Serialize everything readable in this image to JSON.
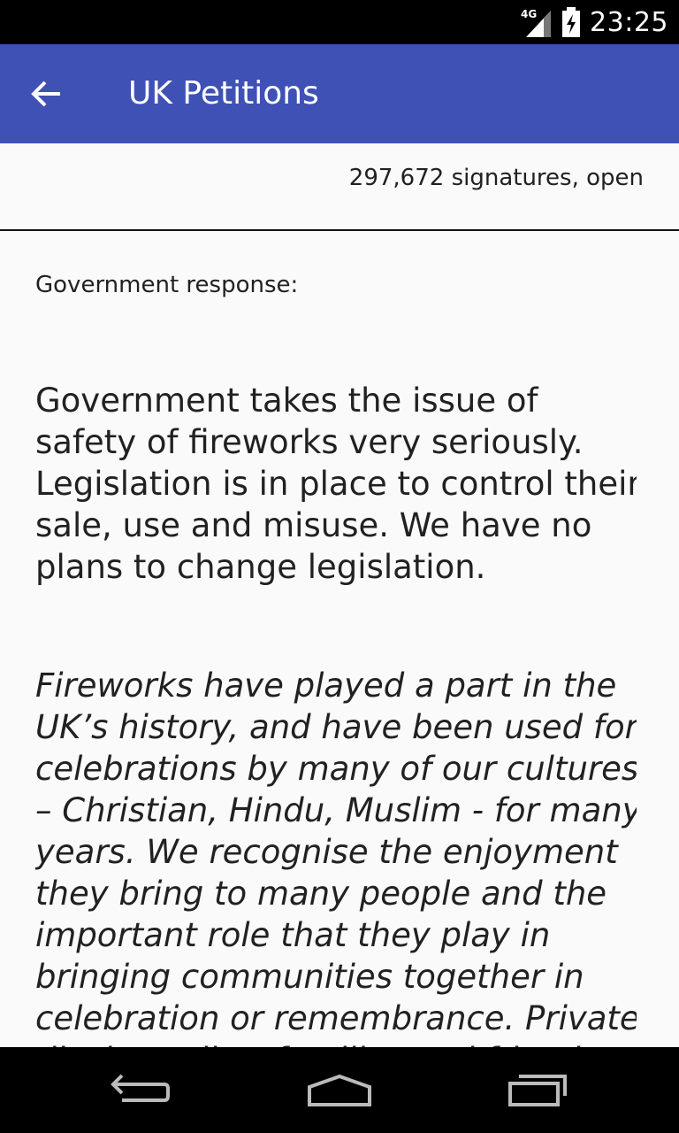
{
  "status_bar": {
    "network": "4G",
    "time": "23:25"
  },
  "app_bar": {
    "title": "UK Petitions",
    "back_icon": "arrow-back-icon"
  },
  "petition": {
    "signatures": "297,672 signatures, open"
  },
  "response": {
    "label": "Government response:",
    "summary": "Government takes the issue of safety of fireworks very seriously. Legislation is in place to control their sale, use and misuse. We have no plans to change legislation.",
    "details": "Fireworks have played a part in the UK’s history, and have been used for celebrations by many of our cultures – Christian, Hindu, Muslim - for many years. We recognise the enjoyment they bring to many people and the important role that they play in bringing communities together in celebration or remembrance.  Private displays allow families and friends to hold their own celebrations."
  },
  "nav_bar": {
    "back": "back-icon",
    "home": "home-icon",
    "recents": "recents-icon"
  },
  "colors": {
    "app_bar": "#3f51b5",
    "background": "#fafafa",
    "text": "#212121"
  }
}
